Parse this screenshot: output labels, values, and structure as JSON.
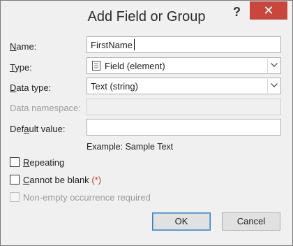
{
  "window": {
    "title": "Add Field or Group",
    "help_glyph": "?",
    "close_glyph": "✕"
  },
  "form": {
    "name": {
      "label": "Name:",
      "value": "FirstName"
    },
    "type": {
      "label": "Type:",
      "value": "Field (element)"
    },
    "data_type": {
      "label": "Data type:",
      "value": "Text (string)"
    },
    "data_namespace": {
      "label": "Data namespace:",
      "value": ""
    },
    "default_value": {
      "label": "Default value:",
      "value": ""
    },
    "example": "Example: Sample Text"
  },
  "options": {
    "repeating": {
      "label": "Repeating",
      "checked": false
    },
    "cannot_be_blank": {
      "label": "Cannot be blank",
      "marker": "(*)",
      "checked": false
    },
    "non_empty": {
      "label": "Non-empty occurrence required",
      "checked": false,
      "disabled": true
    }
  },
  "buttons": {
    "ok": "OK",
    "cancel": "Cancel"
  },
  "colors": {
    "close_bg": "#c9463d",
    "required_marker": "#c0392b",
    "default_button_border": "#3c7fb1"
  }
}
